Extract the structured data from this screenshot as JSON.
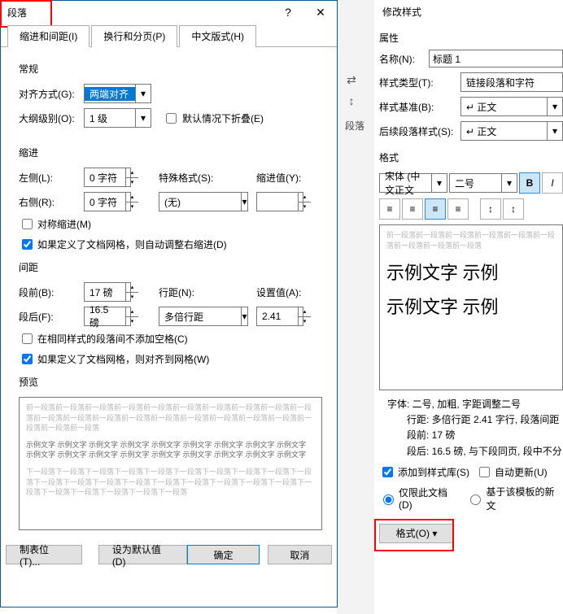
{
  "left": {
    "title": "段落",
    "help": "?",
    "close": "✕",
    "tabs": [
      "缩进和间距(I)",
      "换行和分页(P)",
      "中文版式(H)"
    ],
    "general_h": "常规",
    "align_label": "对齐方式(G):",
    "align_value": "两端对齐",
    "outline_label": "大纲级别(O):",
    "outline_value": "1 级",
    "collapse_cb": "默认情况下折叠(E)",
    "indent_h": "缩进",
    "left_label": "左侧(L):",
    "left_value": "0 字符",
    "right_label": "右侧(R):",
    "right_value": "0 字符",
    "special_label": "特殊格式(S):",
    "special_value": "(无)",
    "indentval_label": "缩进值(Y):",
    "sym_cb": "对称缩进(M)",
    "grid_indent_cb": "如果定义了文档网格，则自动调整右缩进(D)",
    "spacing_h": "间距",
    "before_label": "段前(B):",
    "before_value": "17 磅",
    "after_label": "段后(F):",
    "after_value": "16.5 磅",
    "linesp_label": "行距(N):",
    "linesp_value": "多倍行距",
    "setval_label": "设置值(A):",
    "setval_value": "2.41",
    "nospace_cb": "在相同样式的段落间不添加空格(C)",
    "grid_align_cb": "如果定义了文档网格，则对齐到网格(W)",
    "preview_h": "预览",
    "preview_grey1": "前一段落前一段落前一段落前一段落前一段落前一段落前一段落前一段落前一段落前一段落前一段落前一段落前一段落前一段落前一段落前一段落前一段落前一段落前一段落前一段落前一段落前一段落",
    "preview_dark": "示例文字 示例文字 示例文字 示例文字 示例文字 示例文字 示例文字 示例文字 示例文字 示例文字 示例文字 示例文字 示例文字 示例文字 示例文字 示例文字 示例文字 示例文字",
    "preview_grey2": "下一段落下一段落下一段落下一段落下一段落下一段落下一段落下一段落下一段落下一段落下一段落下一段落下一段落下一段落下一段落下一段落下一段落下一段落下一段落下一段落下一段落下一段落下一段落下一段落下一段落",
    "btn_tabs": "制表位(T)...",
    "btn_default": "设为默认值(D)",
    "btn_ok": "确定",
    "btn_cancel": "取消"
  },
  "right": {
    "title": "修改样式",
    "props_h": "属性",
    "name_label": "名称(N):",
    "name_value": "标题 1",
    "type_label": "样式类型(T):",
    "type_value": "链接段落和字符",
    "base_label": "样式基准(B):",
    "base_value": "↵ 正文",
    "next_label": "后续段落样式(S):",
    "next_value": "↵ 正文",
    "format_h": "格式",
    "font_value": "宋体 (中文正文",
    "size_value": "二号",
    "sample_grey": "前一段落前一段落前一段落前一段落前一段落前一段落前一段落前一段落前一段落",
    "sample_big": "示例文字 示例",
    "descr1": "字体: 二号, 加粗, 字距调整二号",
    "descr2": "行距: 多倍行距 2.41 字行, 段落间距",
    "descr3": "段前: 17 磅",
    "descr4": "段后: 16.5 磅, 与下段同页, 段中不分",
    "add_cb": "添加到样式库(S)",
    "auto_cb": "自动更新(U)",
    "only_radio": "仅限此文档(D)",
    "tmpl_radio": "基于该模板的新文",
    "format_btn": "格式(O) ▾"
  },
  "strip": {
    "crumb": "段落"
  }
}
